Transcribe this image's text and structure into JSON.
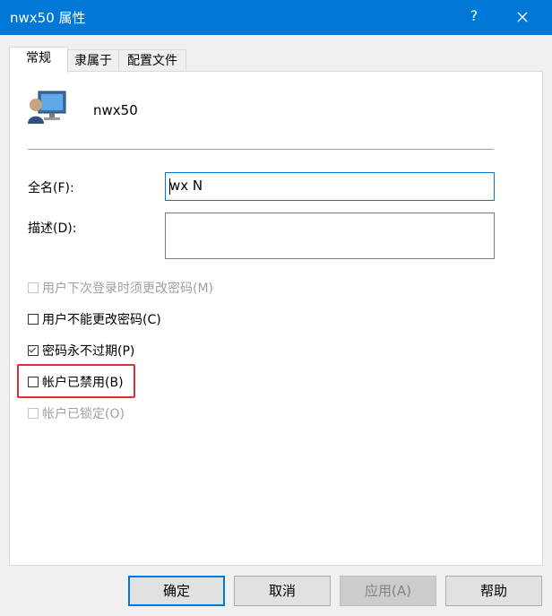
{
  "window": {
    "title": "nwx50 属性",
    "help": "?",
    "close_icon": "close-icon"
  },
  "tabs": [
    {
      "label": "常规",
      "active": true
    },
    {
      "label": "隶属于",
      "active": false
    },
    {
      "label": "配置文件",
      "active": false
    }
  ],
  "user": {
    "name": "nwx50",
    "icon": "user-monitor-icon"
  },
  "fields": {
    "fullname": {
      "label": "全名(F):",
      "value": "wx N"
    },
    "description": {
      "label": "描述(D):",
      "value": ""
    }
  },
  "checkboxes": [
    {
      "label": "用户下次登录时须更改密码(M)",
      "checked": false,
      "enabled": false
    },
    {
      "label": "用户不能更改密码(C)",
      "checked": false,
      "enabled": true
    },
    {
      "label": "密码永不过期(P)",
      "checked": true,
      "enabled": true
    },
    {
      "label": "帐户已禁用(B)",
      "checked": false,
      "enabled": true
    },
    {
      "label": "帐户已锁定(O)",
      "checked": false,
      "enabled": false
    }
  ],
  "buttons": {
    "ok": "确定",
    "cancel": "取消",
    "apply": "应用(A)",
    "help": "帮助"
  },
  "colors": {
    "titlebar": "#0078d7",
    "highlight": "#e03030"
  }
}
